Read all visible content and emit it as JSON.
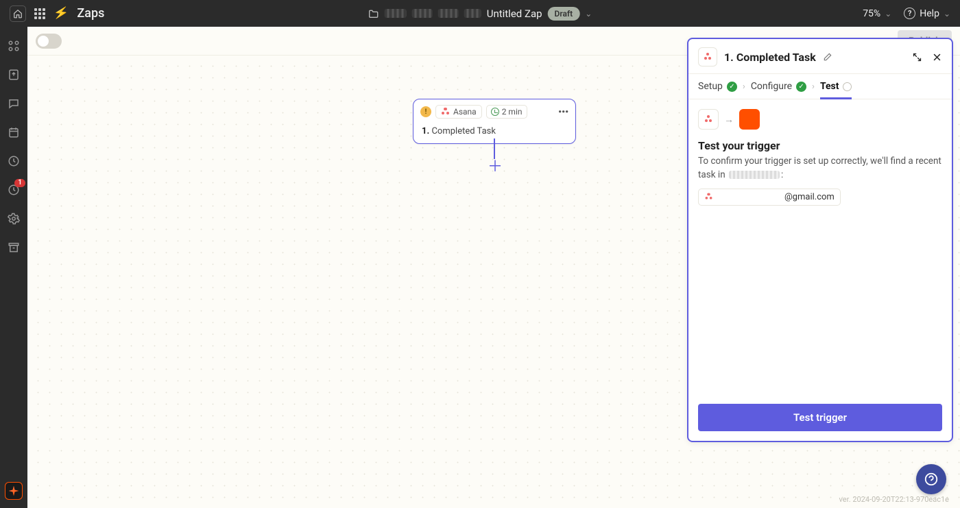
{
  "header": {
    "section_label": "Zaps",
    "zap_name": "Untitled Zap",
    "status_badge": "Draft",
    "zoom": "75%",
    "help_label": "Help"
  },
  "left_rail": {
    "history_badge": "1"
  },
  "toolbar": {
    "publish_label": "Publish"
  },
  "canvas": {
    "node": {
      "app_name": "Asana",
      "interval": "2 min",
      "step_number": "1.",
      "step_title": "Completed Task"
    }
  },
  "panel": {
    "title_number": "1.",
    "title_text": "Completed Task",
    "steps": {
      "setup": "Setup",
      "configure": "Configure",
      "test": "Test"
    },
    "body": {
      "heading": "Test your trigger",
      "line_pre": "To confirm your trigger is set up correctly, we'll find a recent task in ",
      "line_post": ":",
      "account_suffix": "@gmail.com"
    },
    "cta": "Test trigger"
  },
  "footer": {
    "version": "ver. 2024-09-20T22:13-970eac1e"
  }
}
